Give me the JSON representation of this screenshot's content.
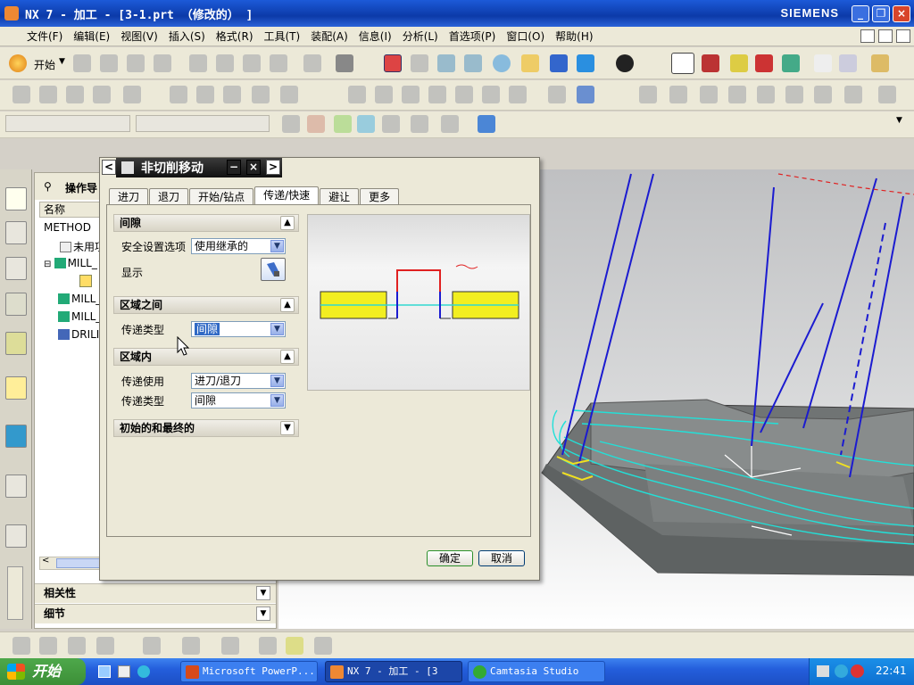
{
  "window": {
    "title": "NX 7 - 加工 - [3-1.prt （修改的） ]",
    "brand": "SIEMENS",
    "minimize": "_",
    "restore": "❐",
    "close": "×"
  },
  "menu": [
    "文件(F)",
    "编辑(E)",
    "视图(V)",
    "插入(S)",
    "格式(R)",
    "工具(T)",
    "装配(A)",
    "信息(I)",
    "分析(L)",
    "首选项(P)",
    "窗口(O)",
    "帮助(H)"
  ],
  "toolbar": {
    "start_label": "开始"
  },
  "navigator": {
    "title": "操作导",
    "column_name": "名称",
    "rows": [
      "METHOD",
      "未用项",
      "MILL_",
      "MILL_",
      "MILL_",
      "DRILI"
    ],
    "related": "相关性",
    "details": "细节"
  },
  "dialog": {
    "title": "非切削移动",
    "tabs": [
      "进刀",
      "退刀",
      "开始/钻点",
      "传递/快速",
      "避让",
      "更多"
    ],
    "active_tab": 3,
    "sections": {
      "clearance": {
        "title": "间隙",
        "safe_label": "安全设置选项",
        "safe_value": "使用继承的",
        "display_label": "显示"
      },
      "between": {
        "title": "区域之间",
        "transfer_type_label": "传递类型",
        "transfer_type_value": "间隙"
      },
      "within": {
        "title": "区域内",
        "transfer_using_label": "传递使用",
        "transfer_using_value": "进刀/退刀",
        "transfer_type_label": "传递类型",
        "transfer_type_value": "间隙"
      },
      "initial_final": {
        "title": "初始的和最终的"
      }
    },
    "ok": "确定",
    "cancel": "取消"
  },
  "taskbar": {
    "start": "开始",
    "tasks": [
      "Microsoft PowerP...",
      "NX 7 - 加工 - [3",
      "Camtasia Studio"
    ],
    "time": "22:41"
  }
}
